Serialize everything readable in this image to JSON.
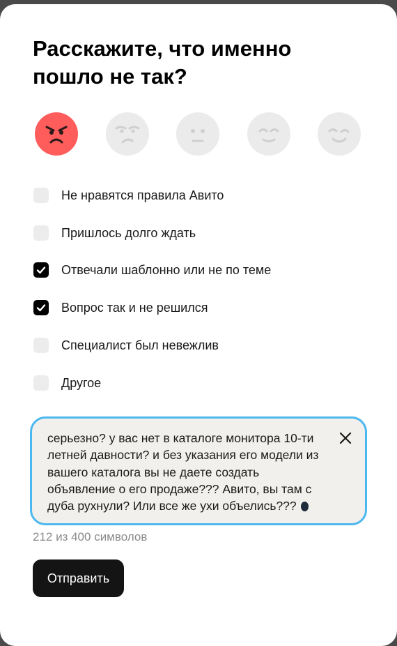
{
  "title": "Расскажите, что именно\nпошло не так?",
  "rating": {
    "selected": 1,
    "faces": [
      {
        "icon": "angry-face-icon",
        "active": true
      },
      {
        "icon": "frowning-face-icon",
        "active": false
      },
      {
        "icon": "neutral-face-icon",
        "active": false
      },
      {
        "icon": "content-face-icon",
        "active": false
      },
      {
        "icon": "winking-face-icon",
        "active": false
      }
    ]
  },
  "options": [
    {
      "label": "Не нравятся правила Авито",
      "checked": false
    },
    {
      "label": "Пришлось долго ждать",
      "checked": false
    },
    {
      "label": "Отвечали шаблонно или не по теме",
      "checked": true
    },
    {
      "label": "Вопрос так и не решился",
      "checked": true
    },
    {
      "label": "Специалист был невежлив",
      "checked": false
    },
    {
      "label": "Другое",
      "checked": false
    }
  ],
  "comment": {
    "value": "серьезно? у вас нет в каталоге монитора 10-ти летней давности? и без указания его модели из вашего каталога вы не даете создать объявление о его продаже??? Авито, вы там с дуба рухнули? Или все же ухи объелись???",
    "clear_icon": "close-icon"
  },
  "counter": "212 из 400 символов",
  "submit_label": "Отправить",
  "colors": {
    "active_face": "#ff5c5c",
    "focus_border": "#4cb8ef",
    "checkbox_checked": "#000000",
    "button": "#141414"
  }
}
